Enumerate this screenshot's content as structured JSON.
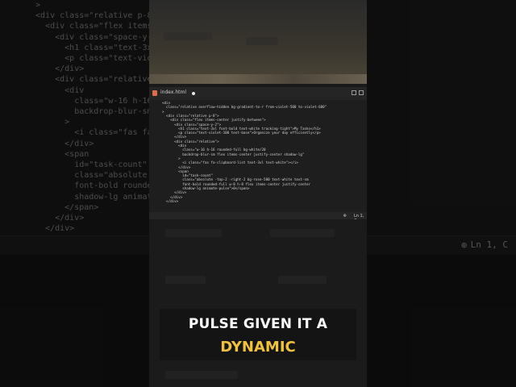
{
  "background_code": [
    "  >",
    "  <div class=\"relative p-8\"",
    "    <div class=\"flex items-",
    "      <div class=\"space-y-2",
    "        <h1 class=\"text-3xl",
    "        <p class=\"text-viol",
    "      </div>",
    "      <div class=\"relative\"",
    "        <div",
    "          class=\"w-16 h-16",
    "          backdrop-blur-sm",
    "        >",
    "          <i class=\"fas fa-",
    "        </div>",
    "        <span",
    "          id=\"task-count\"",
    "          class=\"absolute -",
    "          font-bold rounded",
    "          shadow-lg animate",
    "        </span>",
    "      </div>",
    "    </div>"
  ],
  "background_status": {
    "zoom_icon": "zoom-icon",
    "position": "Ln 1, C"
  },
  "editor": {
    "tab_label": "index.html",
    "code_lines": [
      "<div",
      "  class=\"relative overflow-hidden bg-gradient-to-r from-violet-500 to-violet-600\"",
      ">",
      "  <div class=\"relative p-8\">",
      "    <div class=\"flex items-center justify-between\">",
      "      <div class=\"space-y-2\">",
      "        <h1 class=\"text-3xl font-bold text-white tracking-tight\">My Tasks</h1>",
      "        <p class=\"text-violet-100 text-base\">Organize your day efficiently</p>",
      "      </div>",
      "      <div class=\"relative\">",
      "        <div",
      "          class=\"w-16 h-16 rounded-full bg-white/20",
      "          backdrop-blur-sm flex items-center justify-center shadow-lg\"",
      "        >",
      "          <i class=\"fas fa-clipboard-list text-3xl text-white\"></i>",
      "        </div>",
      "        <span",
      "          id=\"task-count\"",
      "          class=\"absolute -top-2 -right-2 bg-rose-500 text-white text-sm",
      "          font-bold rounded-full w-8 h-8 flex items-center justify-center",
      "          shadow-lg animate-pulse\">0</span>",
      "      </div>",
      "    </div>",
      "  </div>"
    ],
    "status": {
      "zoom_icon": "zoom-icon",
      "position": "Ln 1, C"
    }
  },
  "caption": {
    "line1": "PULSE GIVEN IT A",
    "line2": "DYNAMIC"
  },
  "colors": {
    "caption_highlight": "#f0c23a",
    "tab_icon": "#e06c4b"
  }
}
